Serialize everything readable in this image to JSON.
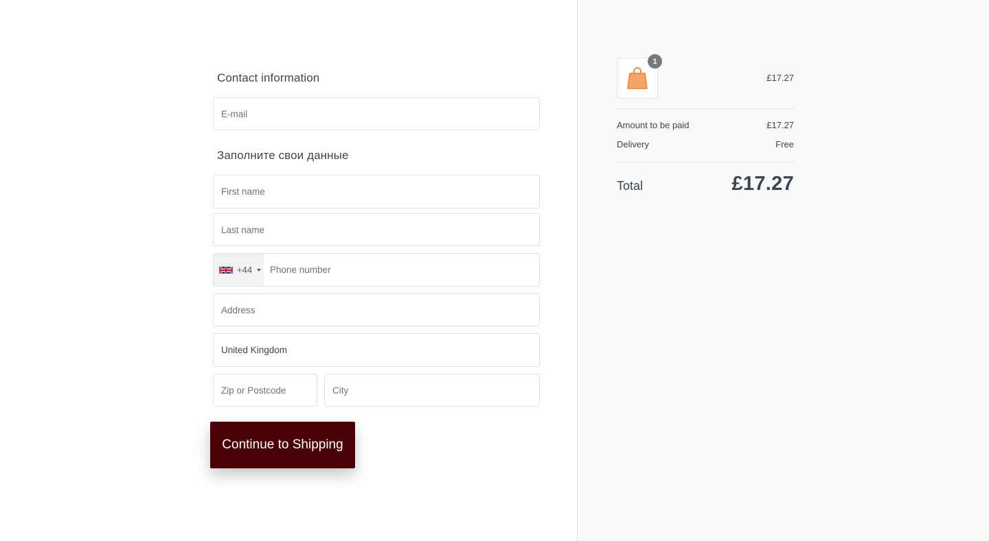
{
  "contact": {
    "title": "Contact information",
    "email_placeholder": "E-mail",
    "email_value": ""
  },
  "details": {
    "title": "Заполните свои данные",
    "first_name_placeholder": "First name",
    "last_name_placeholder": "Last name",
    "phone": {
      "country_flag": "uk-flag-icon",
      "dial_code": "+44",
      "placeholder": "Phone number"
    },
    "address_placeholder": "Address",
    "country_value": "United Kingdom",
    "zip_placeholder": "Zip or Postcode",
    "city_placeholder": "City"
  },
  "actions": {
    "continue_label": "Continue to Shipping",
    "continue_color": "#4a0007"
  },
  "summary": {
    "item": {
      "icon": "shopping-bag-icon",
      "quantity": "1",
      "price": "£17.27"
    },
    "rows": [
      {
        "label": "Amount to be paid",
        "value": "£17.27"
      },
      {
        "label": "Delivery",
        "value": "Free"
      }
    ],
    "total_label": "Total",
    "total_value": "£17.27"
  }
}
